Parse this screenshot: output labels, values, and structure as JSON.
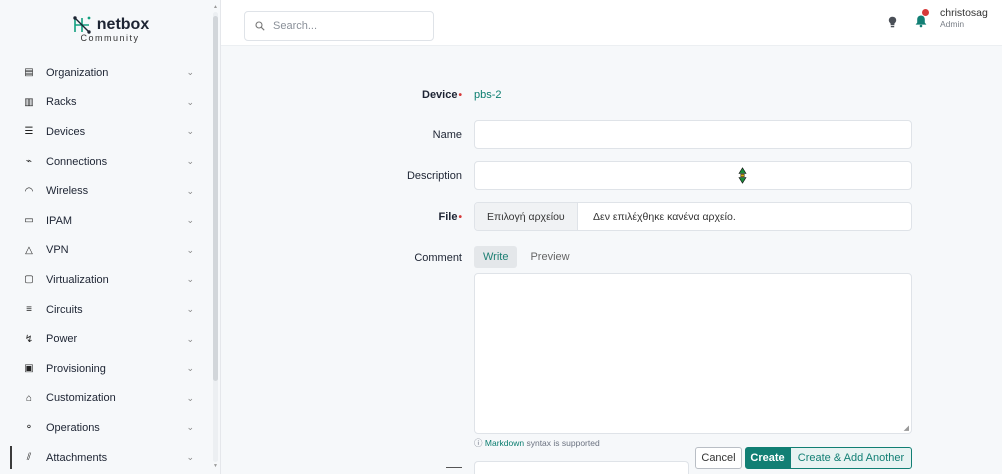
{
  "brand": {
    "name": "netbox",
    "subtitle": "Community"
  },
  "sidebar": {
    "items": [
      {
        "label": "Organization",
        "icon": "building-icon",
        "glyph": "▤"
      },
      {
        "label": "Racks",
        "icon": "rack-icon",
        "glyph": "▥"
      },
      {
        "label": "Devices",
        "icon": "server-icon",
        "glyph": "☰"
      },
      {
        "label": "Connections",
        "icon": "connection-icon",
        "glyph": "⌁"
      },
      {
        "label": "Wireless",
        "icon": "wifi-icon",
        "glyph": "◠"
      },
      {
        "label": "IPAM",
        "icon": "ipam-icon",
        "glyph": "▭"
      },
      {
        "label": "VPN",
        "icon": "vpn-icon",
        "glyph": "△"
      },
      {
        "label": "Virtualization",
        "icon": "monitor-icon",
        "glyph": "▢"
      },
      {
        "label": "Circuits",
        "icon": "circuit-icon",
        "glyph": "≡"
      },
      {
        "label": "Power",
        "icon": "plug-icon",
        "glyph": "↯"
      },
      {
        "label": "Provisioning",
        "icon": "file-icon",
        "glyph": "▣"
      },
      {
        "label": "Customization",
        "icon": "palette-icon",
        "glyph": "⌂"
      },
      {
        "label": "Operations",
        "icon": "operations-icon",
        "glyph": "⚬"
      },
      {
        "label": "Attachments",
        "icon": "paperclip-icon",
        "glyph": "⫽"
      }
    ],
    "active_index": 13
  },
  "header": {
    "search_placeholder": "Search...",
    "user_name": "christosag",
    "user_role": "Admin"
  },
  "form": {
    "device_label": "Device",
    "device_value": "pbs-2",
    "name_label": "Name",
    "name_value": "",
    "description_label": "Description",
    "description_value": "",
    "file_label": "File",
    "file_button": "Επιλογή αρχείου",
    "file_status": "Δεν επιλέχθηκε κανένα αρχείο.",
    "comment_label": "Comment",
    "tab_write": "Write",
    "tab_preview": "Preview",
    "markdown_link": "Markdown",
    "markdown_suffix": " syntax is supported",
    "cancel": "Cancel",
    "create": "Create",
    "create_another": "Create & Add Another"
  },
  "colors": {
    "accent": "#127f74",
    "link": "#0a7d6f",
    "required": "#d63939"
  }
}
